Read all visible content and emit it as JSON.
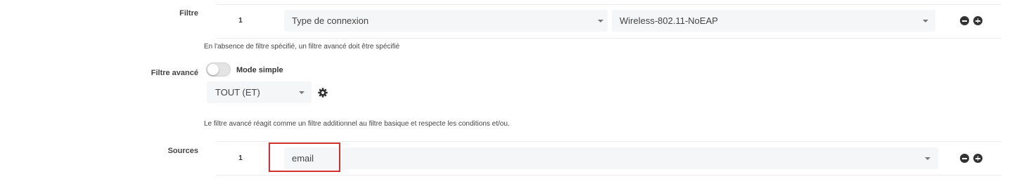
{
  "filtre": {
    "label": "Filtre",
    "row_number": "1",
    "field_select": {
      "value": "Type de connexion"
    },
    "value_select": {
      "value": "Wireless-802.11-NoEAP"
    },
    "help_text": "En l'absence de filtre spécifié, un filtre avancé doit être spécifié"
  },
  "filtre_avance": {
    "label": "Filtre avancé",
    "toggle_label": "Mode simple",
    "toggle_on": false,
    "operator_select": {
      "value": "TOUT (ET)"
    },
    "help_text": "Le filtre avancé réagit comme un filtre additionnel au filtre basique et respecte les conditions et/ou."
  },
  "sources": {
    "label": "Sources",
    "row_number": "1",
    "source_select": {
      "value": "email"
    }
  },
  "colors": {
    "select_bg": "#f4f6f8",
    "icon": "#333333",
    "highlight": "#d32f2f"
  }
}
